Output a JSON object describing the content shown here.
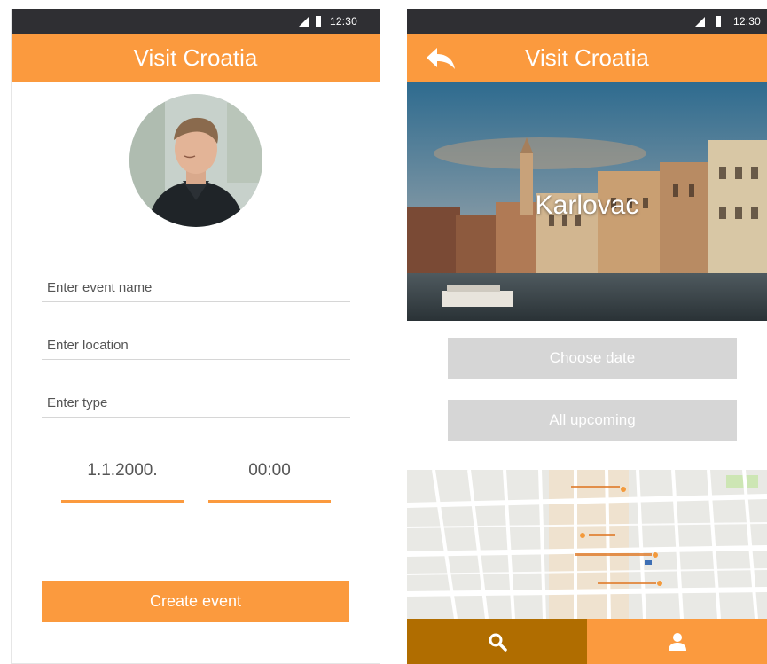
{
  "colors": {
    "accent": "#fb9a3e",
    "accent_dark": "#b06d00",
    "statusbar": "#2f2f33",
    "button_disabled": "#d6d6d6"
  },
  "left_screen": {
    "status": {
      "time": "12:30"
    },
    "appbar": {
      "title": "Visit Croatia"
    },
    "form": {
      "event_name_placeholder": "Enter event name",
      "location_placeholder": "Enter location",
      "type_placeholder": "Enter type",
      "date_value": "1.1.2000.",
      "time_value": "00:00"
    },
    "create_button_label": "Create event"
  },
  "right_screen": {
    "status": {
      "time": "12:30"
    },
    "appbar": {
      "title": "Visit Croatia",
      "back_icon": "back-arrow-icon"
    },
    "hero": {
      "city": "Karlovac"
    },
    "choose_date_label": "Choose date",
    "all_upcoming_label": "All upcoming",
    "bottom_nav": [
      {
        "icon": "search-icon",
        "active": true
      },
      {
        "icon": "person-icon",
        "active": false
      }
    ]
  }
}
